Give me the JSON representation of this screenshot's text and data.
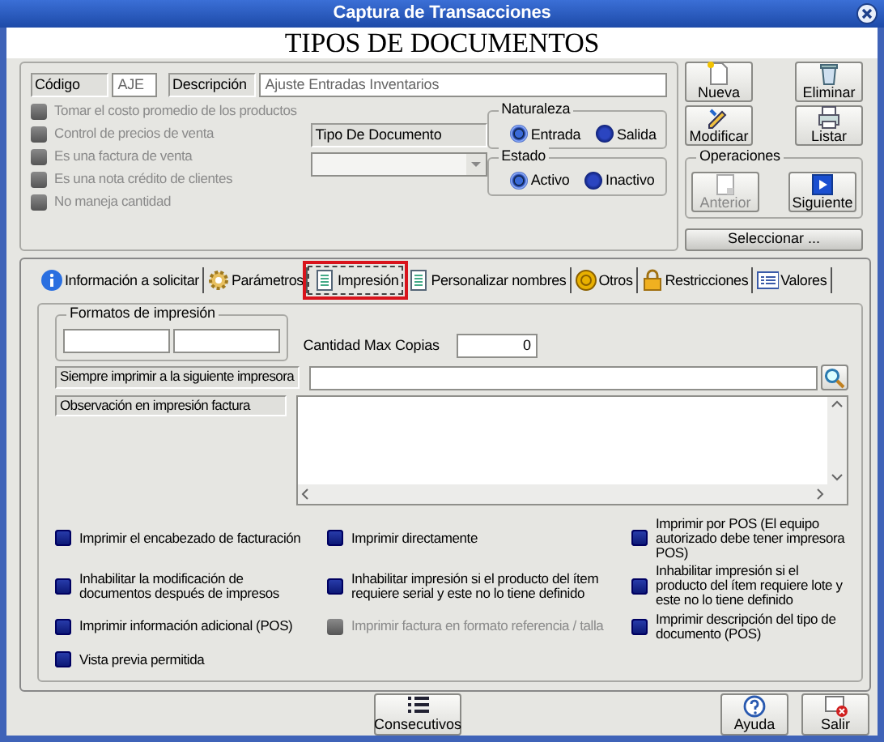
{
  "window": {
    "title": "Captura de Transacciones"
  },
  "header": "TIPOS DE DOCUMENTOS",
  "codigo": {
    "label": "Código",
    "value": "AJE"
  },
  "descripcion": {
    "label": "Descripción",
    "value": "Ajuste Entradas Inventarios"
  },
  "options": [
    {
      "label": "Tomar el costo promedio de los productos",
      "disabled": true
    },
    {
      "label": "Control de precios de venta",
      "disabled": true
    },
    {
      "label": "Es una factura de venta",
      "disabled": true
    },
    {
      "label": "Es una nota crédito de clientes",
      "disabled": true
    },
    {
      "label": "No maneja cantidad",
      "disabled": true
    }
  ],
  "tipo_documento": {
    "label": "Tipo De Documento"
  },
  "naturaleza": {
    "title": "Naturaleza",
    "options": [
      {
        "label": "Entrada",
        "selected": true
      },
      {
        "label": "Salida",
        "selected": false
      }
    ]
  },
  "estado": {
    "title": "Estado",
    "options": [
      {
        "label": "Activo",
        "selected": true
      },
      {
        "label": "Inactivo",
        "selected": false
      }
    ]
  },
  "actions": [
    {
      "label": "Nueva"
    },
    {
      "label": "Eliminar"
    },
    {
      "label": "Modificar"
    },
    {
      "label": "Listar"
    }
  ],
  "operaciones": {
    "title": "Operaciones",
    "buttons": [
      {
        "label": "Anterior",
        "disabled": true
      },
      {
        "label": "Siguiente",
        "disabled": false
      }
    ]
  },
  "select_button": "Seleccionar ...",
  "tabs": [
    {
      "label": "Información a solicitar",
      "selected": false
    },
    {
      "label": "Parámetros",
      "selected": false
    },
    {
      "label": "Impresión",
      "selected": true
    },
    {
      "label": "Personalizar nombres",
      "selected": false
    },
    {
      "label": "Otros",
      "selected": false
    },
    {
      "label": "Restricciones",
      "selected": false
    },
    {
      "label": "Valores",
      "selected": false
    }
  ],
  "formatos": {
    "title": "Formatos de impresión"
  },
  "max_copias": {
    "label": "Cantidad Max Copias",
    "value": "0"
  },
  "impresora": {
    "label": "Siempre imprimir a la siguiente impresora"
  },
  "observacion": {
    "label": "Observación en impresión factura"
  },
  "print_options": [
    {
      "label": "Imprimir el encabezado de facturación",
      "disabled": false
    },
    {
      "label": "Imprimir directamente",
      "disabled": false
    },
    {
      "label": "Imprimir por POS (El equipo autorizado debe tener impresora POS)",
      "disabled": false
    },
    {
      "label": "Inhabilitar la modificación de documentos después de impresos",
      "disabled": false
    },
    {
      "label": "Inhabilitar impresión si el producto del ítem requiere serial y este no lo tiene definido",
      "disabled": false
    },
    {
      "label": "Inhabilitar impresión si el producto del ítem requiere lote y este no lo tiene definido",
      "disabled": false
    },
    {
      "label": "Imprimir información adicional (POS)",
      "disabled": false
    },
    {
      "label": "Imprimir factura en formato referencia / talla",
      "disabled": true
    },
    {
      "label": "Imprimir descripción del tipo de documento (POS)",
      "disabled": false
    },
    {
      "label": "Vista previa permitida",
      "disabled": false
    }
  ],
  "footer_buttons": [
    {
      "label": "Consecutivos"
    },
    {
      "label": "Ayuda"
    },
    {
      "label": "Salir"
    }
  ]
}
